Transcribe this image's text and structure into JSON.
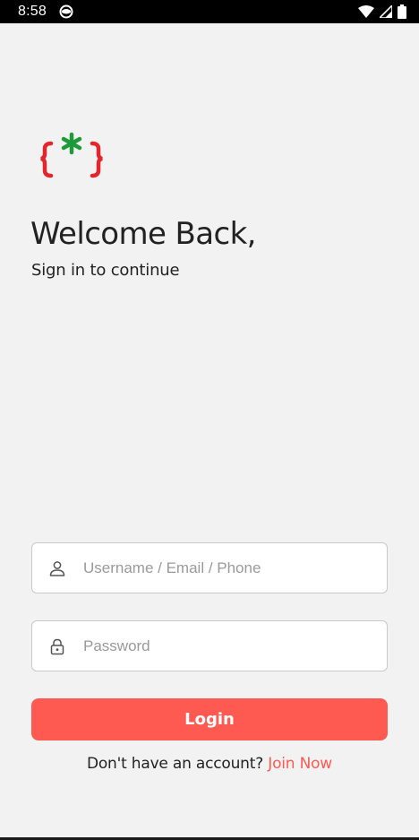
{
  "status_bar": {
    "time": "8:58",
    "app_icon": "circle-notification-icon",
    "icons": [
      "wifi-icon",
      "signal-icon",
      "battery-icon"
    ]
  },
  "logo": {
    "icon": "curly-braces-asterisk-logo",
    "colors": {
      "braces": "#e3262b",
      "asterisk": "#1f9a3b"
    }
  },
  "header": {
    "title": "Welcome Back,",
    "subtitle": "Sign in to continue"
  },
  "form": {
    "username": {
      "placeholder": "Username / Email / Phone",
      "value": "",
      "icon": "user-icon"
    },
    "password": {
      "placeholder": "Password",
      "value": "",
      "icon": "lock-icon"
    },
    "login_label": "Login"
  },
  "footer": {
    "prompt": "Don't have an account?",
    "join_label": "Join Now"
  },
  "colors": {
    "accent": "#ff5a52",
    "background": "#f2f2f2",
    "text": "#222222"
  }
}
